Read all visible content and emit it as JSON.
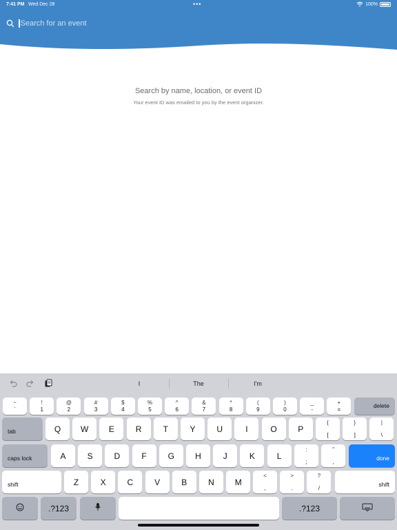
{
  "colors": {
    "header_blue": "#3f86c9",
    "keyboard_bg": "#d1d3d9",
    "done_blue": "#1a82fb"
  },
  "status_bar": {
    "time": "7:41 PM",
    "date": "Wed Dec 28",
    "battery": "100%",
    "battery_level": 1.0
  },
  "search": {
    "placeholder": "Search for an event",
    "value": ""
  },
  "empty_state": {
    "title": "Search by name, location, or event ID",
    "subtitle": "Your event ID was emailed to you by the event organizer."
  },
  "keyboard": {
    "suggestions": [
      "I",
      "The",
      "I'm"
    ],
    "number_row": [
      {
        "top": "~",
        "bot": "`"
      },
      {
        "top": "!",
        "bot": "1"
      },
      {
        "top": "@",
        "bot": "2"
      },
      {
        "top": "#",
        "bot": "3"
      },
      {
        "top": "$",
        "bot": "4"
      },
      {
        "top": "%",
        "bot": "5"
      },
      {
        "top": "^",
        "bot": "6"
      },
      {
        "top": "&",
        "bot": "7"
      },
      {
        "top": "*",
        "bot": "8"
      },
      {
        "top": "(",
        "bot": "9"
      },
      {
        "top": ")",
        "bot": "0"
      },
      {
        "top": "_",
        "bot": "-"
      },
      {
        "top": "+",
        "bot": "="
      }
    ],
    "delete_label": "delete",
    "tab_label": "tab",
    "row_q": [
      "Q",
      "W",
      "E",
      "R",
      "T",
      "Y",
      "U",
      "I",
      "O",
      "P"
    ],
    "row_q_extra": [
      {
        "top": "{",
        "bot": "["
      },
      {
        "top": "}",
        "bot": "]"
      },
      {
        "top": "|",
        "bot": "\\"
      }
    ],
    "caps_label": "caps lock",
    "row_a": [
      "A",
      "S",
      "D",
      "F",
      "G",
      "H",
      "J",
      "K",
      "L"
    ],
    "row_a_extra": [
      {
        "top": ":",
        "bot": ";"
      },
      {
        "top": "\"",
        "bot": ","
      }
    ],
    "done_label": "done",
    "shift_label": "shift",
    "row_z": [
      "Z",
      "X",
      "C",
      "V",
      "B",
      "N",
      "M"
    ],
    "row_z_extra": [
      {
        "top": "<",
        "bot": ","
      },
      {
        "top": ">",
        "bot": "."
      },
      {
        "top": "?",
        "bot": "/"
      }
    ],
    "numbers_label": ".?123",
    "icons": {
      "undo": "undo-icon",
      "redo": "redo-icon",
      "clipboard": "clipboard-icon",
      "emoji": "emoji-icon",
      "mic": "microphone-icon",
      "hide": "keyboard-dismiss-icon"
    }
  }
}
